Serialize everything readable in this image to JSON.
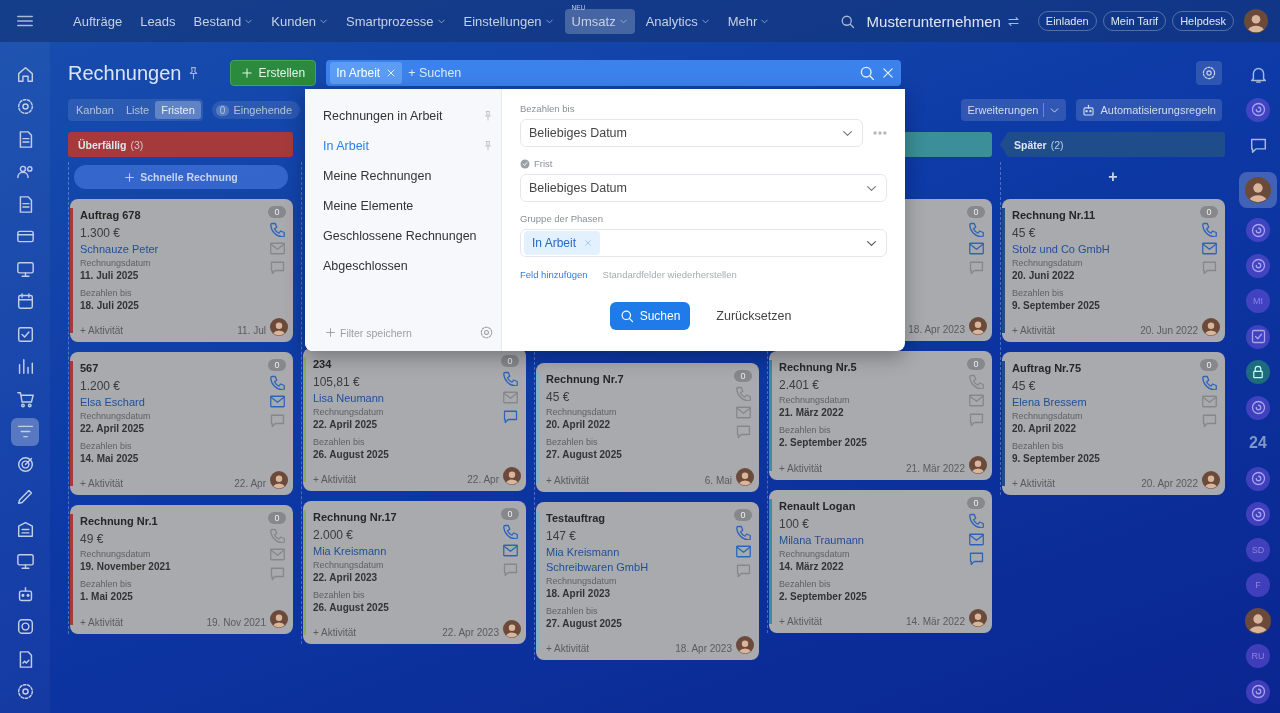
{
  "top_bar": {
    "menu": [
      {
        "label": "Aufträge",
        "dropdown": false,
        "selected": false
      },
      {
        "label": "Leads",
        "dropdown": false,
        "selected": false
      },
      {
        "label": "Bestand",
        "dropdown": true,
        "selected": false
      },
      {
        "label": "Kunden",
        "dropdown": true,
        "selected": false
      },
      {
        "label": "Smartprozesse",
        "dropdown": true,
        "selected": false
      },
      {
        "label": "Einstellungen",
        "dropdown": true,
        "selected": false
      },
      {
        "label": "Umsatz",
        "dropdown": true,
        "selected": true,
        "badge": "NEU"
      },
      {
        "label": "Analytics",
        "dropdown": true,
        "selected": false
      },
      {
        "label": "Mehr",
        "dropdown": true,
        "selected": false
      }
    ],
    "company": "Musterunternehmen",
    "buttons": [
      "Einladen",
      "Mein Tarif",
      "Helpdesk"
    ]
  },
  "left_sidebar": {
    "items": [
      {
        "kind": "home",
        "selected": false
      },
      {
        "kind": "gear",
        "selected": false
      },
      {
        "kind": "doc",
        "selected": false
      },
      {
        "kind": "people",
        "selected": false
      },
      {
        "kind": "doc",
        "selected": false
      },
      {
        "kind": "card",
        "selected": false
      },
      {
        "kind": "monitor",
        "selected": false
      },
      {
        "kind": "calendar",
        "selected": false
      },
      {
        "kind": "checkbox",
        "selected": false
      },
      {
        "kind": "chart",
        "selected": false
      },
      {
        "kind": "cart",
        "selected": false
      },
      {
        "kind": "filter",
        "selected": true
      },
      {
        "kind": "target",
        "selected": false
      },
      {
        "kind": "pen",
        "selected": false
      },
      {
        "kind": "building",
        "selected": false
      },
      {
        "kind": "monitor",
        "selected": false
      },
      {
        "kind": "robot",
        "selected": false
      },
      {
        "kind": "box",
        "selected": false
      },
      {
        "kind": "docsign",
        "selected": false
      },
      {
        "kind": "gear",
        "selected": false
      }
    ]
  },
  "right_sidebar": {
    "items": [
      {
        "kind": "bell",
        "selected": false
      },
      {
        "kind": "openline",
        "selected": false
      },
      {
        "kind": "chat",
        "selected": false
      },
      {
        "kind": "avatar",
        "selected": true
      },
      {
        "kind": "openline",
        "selected": false
      },
      {
        "kind": "openline",
        "selected": false
      },
      {
        "kind": "initials",
        "text": "MI",
        "selected": false
      },
      {
        "kind": "checkbox",
        "selected": false
      },
      {
        "kind": "lock",
        "selected": false
      },
      {
        "kind": "openline",
        "selected": false
      },
      {
        "kind": "number",
        "text": "24",
        "selected": false
      },
      {
        "kind": "openline",
        "selected": false
      },
      {
        "kind": "openline",
        "selected": false
      },
      {
        "kind": "initials",
        "text": "SD",
        "selected": false
      },
      {
        "kind": "initials",
        "text": "F",
        "selected": false
      },
      {
        "kind": "avatar",
        "selected": false
      },
      {
        "kind": "initials",
        "text": "RU",
        "selected": false
      },
      {
        "kind": "openline",
        "selected": false
      }
    ]
  },
  "page": {
    "title": "Rechnungen",
    "create_button": "Erstellen",
    "search": {
      "chip": "In Arbeit",
      "placeholder": "+ Suchen"
    },
    "views": [
      {
        "label": "Kanban",
        "selected": false
      },
      {
        "label": "Liste",
        "selected": false
      },
      {
        "label": "Fristen",
        "selected": true
      }
    ],
    "incoming": {
      "count": "0",
      "label": "Eingehende"
    },
    "extensions_button": "Erweiterungen",
    "automation_button": "Automatisierungsregeln"
  },
  "board": {
    "columns": [
      {
        "header": {
          "title": "Überfällig",
          "count": "(3)",
          "color": "#a63a3a"
        },
        "color": "#a63a3a",
        "add": "Schnelle Rechnung",
        "cards": [
          {
            "title": "Auftrag 678",
            "amount": "1.300 €",
            "contacts": [
              "Schnauze Peter"
            ],
            "date_label": "Rechnungsdatum",
            "date": "11. Juli 2025",
            "due_label": "Bezahlen bis",
            "due": "18. Juli 2025",
            "activity": "+ Aktivität",
            "footer_date": "11. Jul",
            "counter": "0",
            "phone": true,
            "mail": false,
            "chat": false
          },
          {
            "title": "567",
            "amount": "1.200 €",
            "contacts": [
              "Elsa Eschard"
            ],
            "date_label": "Rechnungsdatum",
            "date": "22. April 2025",
            "due_label": "Bezahlen bis",
            "due": "14. Mai 2025",
            "activity": "+ Aktivität",
            "footer_date": "22. Apr",
            "counter": "0",
            "phone": true,
            "mail": true,
            "chat": false
          },
          {
            "title": "Rechnung Nr.1",
            "amount": "49 €",
            "date_label": "Rechnungsdatum",
            "date": "19. November 2021",
            "due_label": "Bezahlen bis",
            "due": "1. Mai 2025",
            "activity": "+ Aktivität",
            "footer_date": "19. Nov 2021",
            "counter": "0",
            "phone": false,
            "mail": false,
            "chat": false
          }
        ]
      },
      {
        "color": "#8fae5c",
        "cards": [
          {
            "title": "234",
            "amount": "105,81 €",
            "contacts": [
              "Lisa Neumann"
            ],
            "date_label": "Rechnungsdatum",
            "date": "22. April 2025",
            "due_label": "Bezahlen bis",
            "due": "26. August 2025",
            "activity": "+ Aktivität",
            "footer_date": "22. Apr",
            "counter": "0",
            "phone": true,
            "mail": false,
            "chat": true
          },
          {
            "title": "Rechnung Nr.17",
            "amount": "2.000 €",
            "contacts": [
              "Mia Kreismann"
            ],
            "date_label": "Rechnungsdatum",
            "date": "22. April 2023",
            "due_label": "Bezahlen bis",
            "due": "26. August 2025",
            "activity": "+ Aktivität",
            "footer_date": "22. Apr 2023",
            "counter": "0",
            "phone": true,
            "mail": true,
            "chat": false
          }
        ]
      },
      {
        "color": "#7fb4cc",
        "cards": [
          {
            "title": "Rechnung Nr.7",
            "amount": "45 €",
            "date_label": "Rechnungsdatum",
            "date": "20. April 2022",
            "due_label": "Bezahlen bis",
            "due": "27. August 2025",
            "activity": "+ Aktivität",
            "footer_date": "6. Mai",
            "counter": "0",
            "phone": false,
            "mail": false,
            "chat": false
          },
          {
            "title": "Testauftrag",
            "amount": "147 €",
            "contacts": [
              "Mia Kreismann",
              "Schreibwaren GmbH"
            ],
            "date_label": "Rechnungsdatum",
            "date": "18. April 2023",
            "due_label": "Bezahlen bis",
            "due": "27. August 2025",
            "activity": "+ Aktivität",
            "footer_date": "18. Apr 2023",
            "counter": "0",
            "phone": true,
            "mail": true,
            "chat": false
          }
        ]
      },
      {
        "header": {
          "color": "#3a8f98"
        },
        "color": "#3a8f98",
        "cards": [
          {
            "footer_date": "18. Apr 2023",
            "counter": "0",
            "phone": true,
            "mail": true,
            "chat": false
          },
          {
            "title": "Rechnung Nr.5",
            "amount": "2.401 €",
            "date_label": "Rechnungsdatum",
            "date": "21. März 2022",
            "due_label": "Bezahlen bis",
            "due": "2. September 2025",
            "activity": "+ Aktivität",
            "footer_date": "21. Mär 2022",
            "counter": "0",
            "phone": false,
            "mail": false,
            "chat": false
          },
          {
            "title": "Renault Logan",
            "amount": "100 €",
            "contacts": [
              "Milana Traumann"
            ],
            "date_label": "Rechnungsdatum",
            "date": "14. März 2022",
            "due_label": "Bezahlen bis",
            "due": "2. September 2025",
            "activity": "+ Aktivität",
            "footer_date": "14. Mär 2022",
            "counter": "0",
            "phone": true,
            "mail": true,
            "chat": true
          }
        ]
      },
      {
        "header": {
          "title": "Später",
          "count": "(2)",
          "color": "#1f4d8c"
        },
        "color": "#1f4d8c",
        "add": "+",
        "cards": [
          {
            "title": "Rechnung Nr.11",
            "amount": "45 €",
            "contacts": [
              "Stolz und Co GmbH"
            ],
            "date_label": "Rechnungsdatum",
            "date": "20. Juni 2022",
            "due_label": "Bezahlen bis",
            "due": "9. September 2025",
            "activity": "+ Aktivität",
            "footer_date": "20. Jun 2022",
            "counter": "0",
            "phone": true,
            "mail": true,
            "chat": false
          },
          {
            "title": "Auftrag Nr.75",
            "amount": "45 €",
            "contacts": [
              "Elena Bressem"
            ],
            "date_label": "Rechnungsdatum",
            "date": "20. April 2022",
            "due_label": "Bezahlen bis",
            "due": "9. September 2025",
            "activity": "+ Aktivität",
            "footer_date": "20. Apr 2022",
            "counter": "0",
            "phone": true,
            "mail": false,
            "chat": false
          }
        ]
      }
    ]
  },
  "filter_popup": {
    "presets": [
      {
        "label": "Rechnungen in Arbeit",
        "pinned": true,
        "selected": false
      },
      {
        "label": "In Arbeit",
        "pinned": true,
        "selected": true
      },
      {
        "label": "Meine Rechnungen",
        "pinned": false,
        "selected": false
      },
      {
        "label": "Meine Elemente",
        "pinned": false,
        "selected": false
      },
      {
        "label": "Geschlossene Rechnungen",
        "pinned": false,
        "selected": false
      },
      {
        "label": "Abgeschlossen",
        "pinned": false,
        "selected": false
      }
    ],
    "save_filter": "Filter speichern",
    "fields": [
      {
        "kind": "select",
        "label": "Bezahlen bis",
        "value": "Beliebiges Datum",
        "more": true,
        "required": false
      },
      {
        "kind": "select",
        "label": "Frist",
        "value": "Beliebiges Datum",
        "more": false,
        "required": true
      },
      {
        "kind": "tags",
        "label": "Gruppe der Phasen",
        "tags": [
          "In Arbeit"
        ],
        "more": false,
        "required": false
      }
    ],
    "add_field": "Feld hinzufügen",
    "restore_fields": "Standardfelder wiederherstellen",
    "search_button": "Suchen",
    "reset_button": "Zurücksetzen"
  }
}
